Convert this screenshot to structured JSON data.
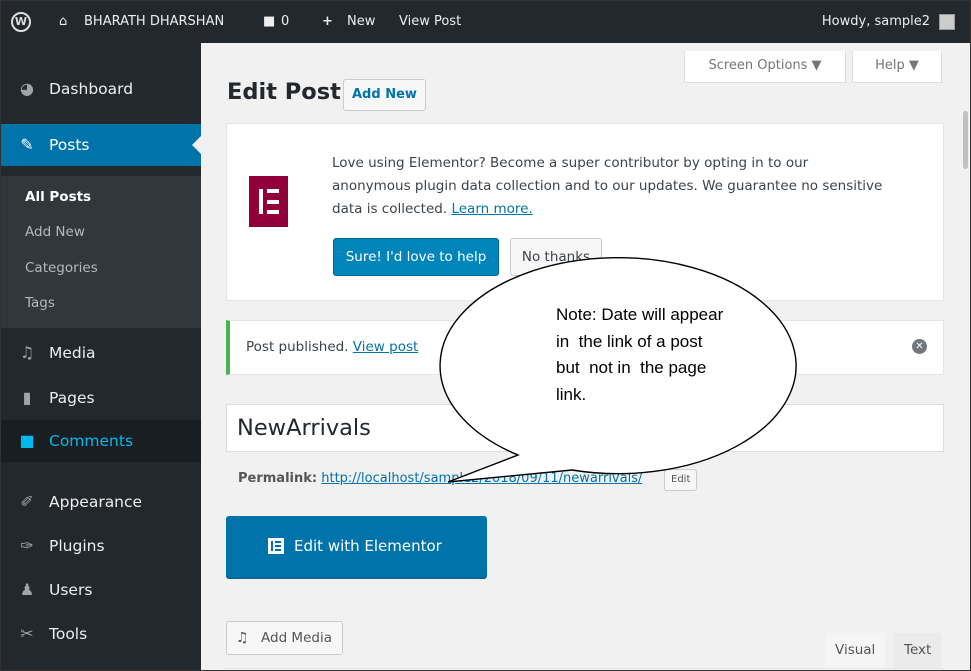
{
  "admin_bar": {
    "wp_logo": "W",
    "site_name": "BHARATH DHARSHAN",
    "comment_count": "0",
    "new_label": "New",
    "view_post": "View Post",
    "howdy": "Howdy, sample2"
  },
  "sidebar": {
    "dashboard": "Dashboard",
    "posts": "Posts",
    "submenu": [
      "All Posts",
      "Add New",
      "Categories",
      "Tags"
    ],
    "media": "Media",
    "pages": "Pages",
    "comments": "Comments",
    "appearance": "Appearance",
    "plugins": "Plugins",
    "users": "Users",
    "tools": "Tools"
  },
  "header": {
    "screen_options": "Screen Options ▼",
    "help": "Help ▼",
    "title": "Edit Post",
    "add_new": "Add New"
  },
  "elementor_notice": {
    "line1": "Love using Elementor? Become a super contributor by opting in to our",
    "line2": "anonymous plugin data collection and to our updates. We guarantee no sensitive",
    "line3": "data is collected.",
    "learn_more": "Learn more.",
    "accept": "Sure! I'd love to help",
    "decline": "No thanks"
  },
  "published_notice": {
    "text": "Post published.",
    "link": "View post"
  },
  "post": {
    "title": "NewArrivals",
    "permalink_label": "Permalink:",
    "permalink_url": "http://localhost/sample2/2018/09/11/newarrivals/",
    "permalink_edit": "Edit",
    "edit_with_elementor": "Edit with Elementor",
    "add_media": "Add Media",
    "tab_visual": "Visual",
    "tab_text": "Text"
  },
  "callout": {
    "lines": [
      "Note: Date will appear",
      "in  the link of a post",
      "but  not in  the page",
      "link."
    ]
  },
  "colors": {
    "admin_dark": "#23282d",
    "active_blue": "#0073aa",
    "elementor": "#92003b",
    "success_green": "#46b450",
    "comments_accent": "#00b9eb"
  }
}
